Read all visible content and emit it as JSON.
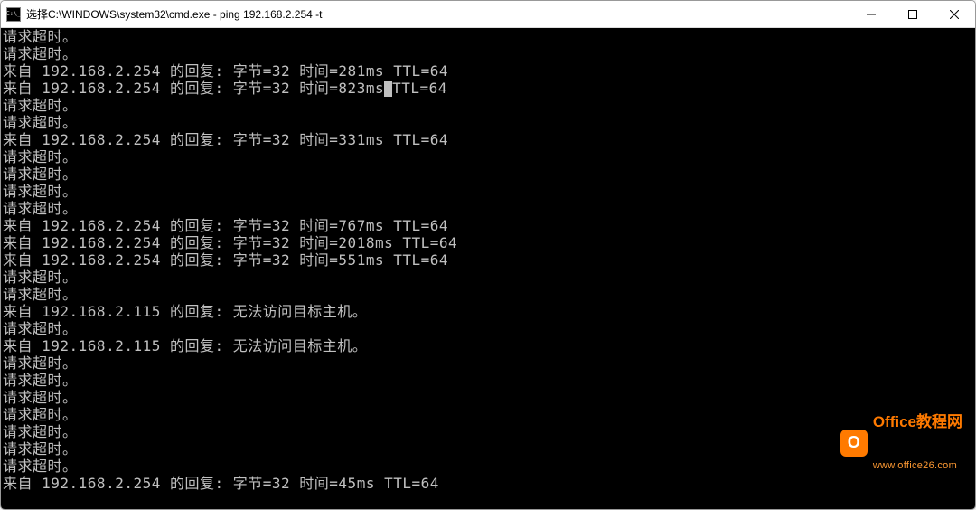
{
  "window": {
    "title": "选择C:\\WINDOWS\\system32\\cmd.exe - ping  192.168.2.254 -t"
  },
  "console": {
    "lines": [
      "请求超时。",
      "请求超时。",
      "来自 192.168.2.254 的回复: 字节=32 时间=281ms TTL=64",
      {
        "pre": "来自 192.168.2.254 的回复: 字节=32 时间=823ms",
        "post": "TTL=64",
        "cursor": true
      },
      "请求超时。",
      "请求超时。",
      "来自 192.168.2.254 的回复: 字节=32 时间=331ms TTL=64",
      "请求超时。",
      "请求超时。",
      "请求超时。",
      "请求超时。",
      "来自 192.168.2.254 的回复: 字节=32 时间=767ms TTL=64",
      "来自 192.168.2.254 的回复: 字节=32 时间=2018ms TTL=64",
      "来自 192.168.2.254 的回复: 字节=32 时间=551ms TTL=64",
      "请求超时。",
      "请求超时。",
      "来自 192.168.2.115 的回复: 无法访问目标主机。",
      "请求超时。",
      "来自 192.168.2.115 的回复: 无法访问目标主机。",
      "请求超时。",
      "请求超时。",
      "请求超时。",
      "请求超时。",
      "请求超时。",
      "请求超时。",
      "请求超时。",
      "来自 192.168.2.254 的回复: 字节=32 时间=45ms TTL=64"
    ]
  },
  "watermark": {
    "title": "Office教程网",
    "url": "www.office26.com",
    "logo_letter": "O"
  }
}
